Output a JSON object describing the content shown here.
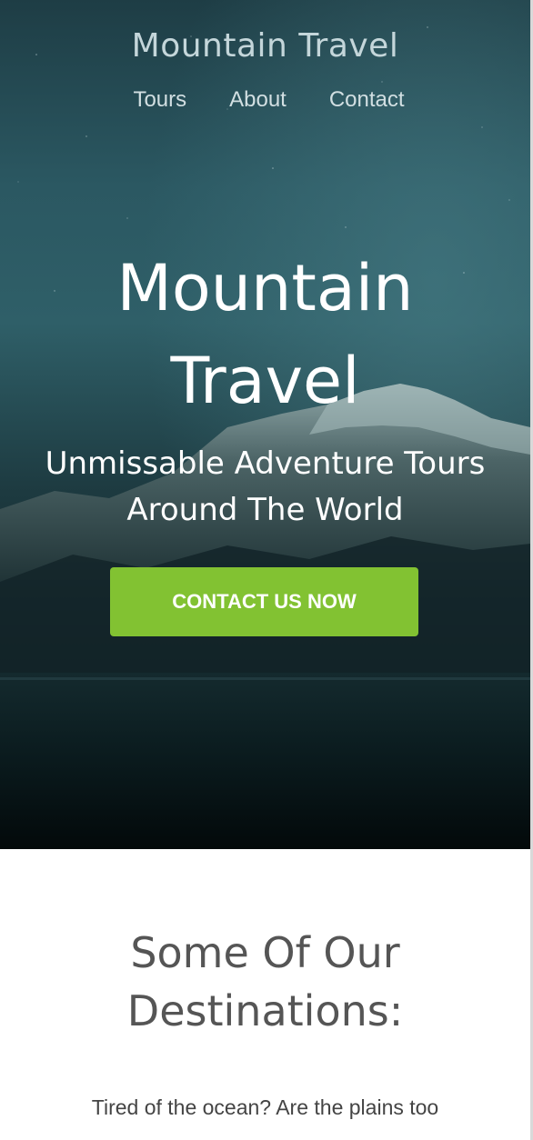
{
  "header": {
    "brand": "Mountain Travel",
    "nav": [
      {
        "label": "Tours"
      },
      {
        "label": "About"
      },
      {
        "label": "Contact"
      }
    ]
  },
  "hero": {
    "title_line1": "Mountain",
    "title_line2": "Travel",
    "subtitle_line1": "Unmissable Adventure Tours",
    "subtitle_line2": "Around The World",
    "cta_label": "CONTACT US NOW",
    "background": "night-mountain-lake-photo"
  },
  "destinations": {
    "title_line1": "Some Of Our",
    "title_line2": "Destinations:",
    "intro": "Tired of the ocean? Are the plains too"
  },
  "colors": {
    "accent": "#82c232",
    "heading": "#555555",
    "body_text": "#444444",
    "hero_text": "#ffffff",
    "brand_text": "#c4d6da"
  }
}
